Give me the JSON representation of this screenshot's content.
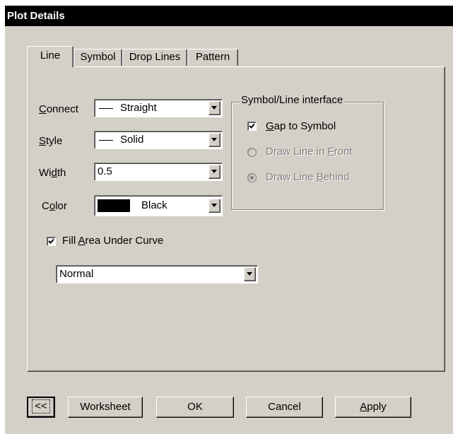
{
  "window": {
    "title": "Plot Details"
  },
  "tabs": [
    {
      "label": "Line",
      "active": true
    },
    {
      "label": "Symbol",
      "active": false
    },
    {
      "label": "Drop Lines",
      "active": false
    },
    {
      "label": "Pattern",
      "active": false
    }
  ],
  "fields": {
    "connect": {
      "label_pre": "",
      "label_u": "C",
      "label_post": "onnect",
      "value": "Straight"
    },
    "style": {
      "label_pre": "",
      "label_u": "S",
      "label_post": "tyle",
      "value": "Solid"
    },
    "width": {
      "label_pre": "Wi",
      "label_u": "d",
      "label_post": "th",
      "value": "0.5"
    },
    "color": {
      "label_pre": "C",
      "label_u": "o",
      "label_post": "lor",
      "value": "Black",
      "swatch": "#000000"
    }
  },
  "fill": {
    "checked": true,
    "label_pre": "Fill ",
    "label_u": "A",
    "label_post": "rea Under Curve",
    "mode": "Normal"
  },
  "symbol_line": {
    "group_title": "Symbol/Line interface",
    "gap": {
      "checked": true,
      "label_pre": "",
      "label_u": "G",
      "label_post": "ap to Symbol"
    },
    "front": {
      "label_pre": "Draw Line in ",
      "label_u": "F",
      "label_post": "ront",
      "selected": false,
      "enabled": false
    },
    "behind": {
      "label_pre": "Draw Line ",
      "label_u": "B",
      "label_post": "ehind",
      "selected": true,
      "enabled": false
    }
  },
  "buttons": {
    "collapse": "<<",
    "worksheet": "Worksheet",
    "ok": "OK",
    "cancel": "Cancel",
    "apply_u": "A",
    "apply_post": "pply"
  },
  "colors": {
    "face": "#d4d0c8",
    "title_bg": "#000000",
    "disabled_text": "#808080"
  }
}
